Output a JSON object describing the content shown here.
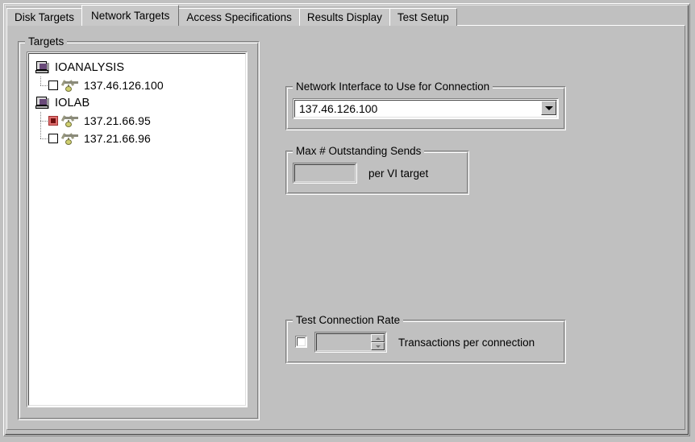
{
  "tabs": [
    {
      "label": "Disk Targets",
      "selected": false
    },
    {
      "label": "Network Targets",
      "selected": true
    },
    {
      "label": "Access Specifications",
      "selected": false
    },
    {
      "label": "Results Display",
      "selected": false
    },
    {
      "label": "Test Setup",
      "selected": false
    }
  ],
  "targets_group": {
    "title": "Targets",
    "tree": [
      {
        "type": "host",
        "label": "IOANALYSIS",
        "icon": "computer-icon",
        "children": [
          {
            "label": "137.46.126.100",
            "checked": false,
            "icon": "vi-connector-icon"
          }
        ]
      },
      {
        "type": "host",
        "label": "IOLAB",
        "icon": "computer-icon",
        "children": [
          {
            "label": "137.21.66.95",
            "checked": true,
            "icon": "vi-connector-icon"
          },
          {
            "label": "137.21.66.96",
            "checked": false,
            "icon": "vi-connector-icon"
          }
        ]
      }
    ]
  },
  "network_interface": {
    "title": "Network Interface to Use for Connection",
    "selected_value": "137.46.126.100",
    "options": [
      "137.46.126.100"
    ]
  },
  "max_outstanding_sends": {
    "title": "Max # Outstanding Sends",
    "value": "",
    "placeholder": "",
    "side_label": "per VI target"
  },
  "test_connection_rate": {
    "title": "Test Connection Rate",
    "enabled": false,
    "value": "",
    "side_label": "Transactions per connection"
  },
  "colors": {
    "face": "#c0c0c0",
    "shadow": "#808080",
    "highlight": "#ffffff",
    "dark_shadow": "#404040",
    "window": "#ffffff",
    "text": "#000000",
    "disabled_text": "#808080",
    "selected_checkbox": "#e07070"
  }
}
